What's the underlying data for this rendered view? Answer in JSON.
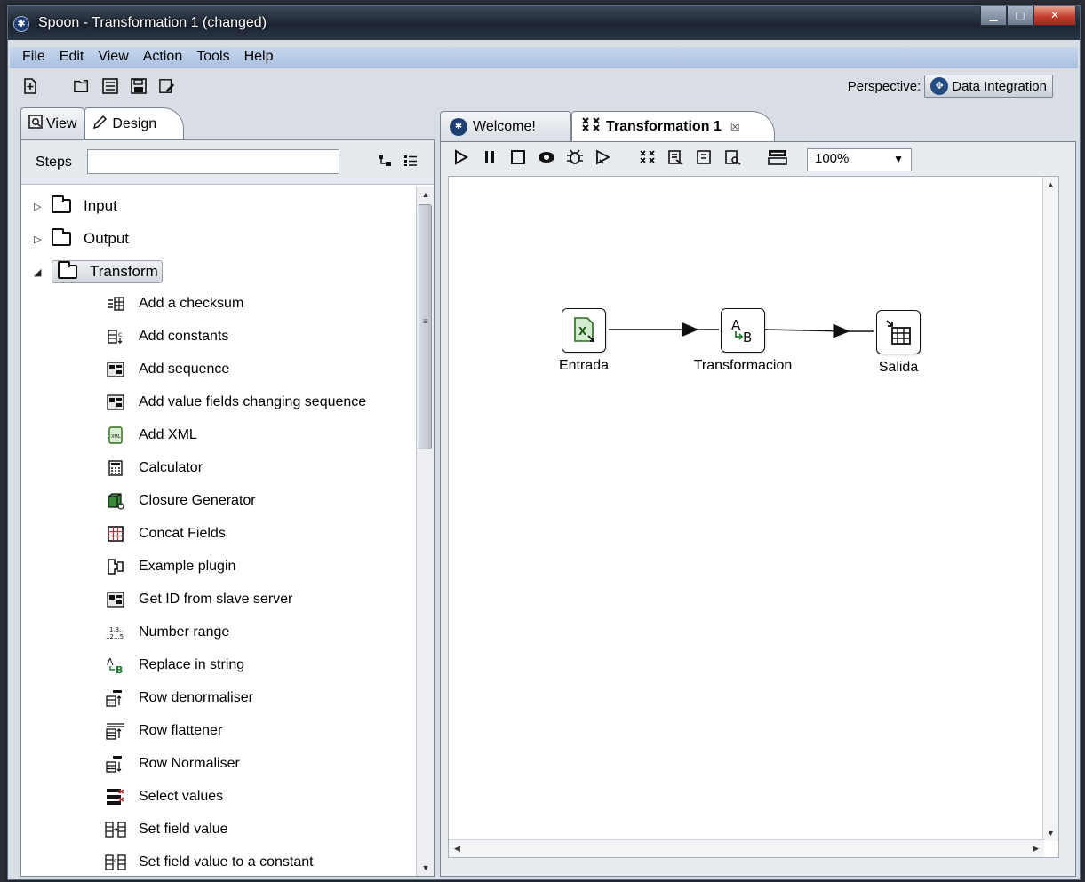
{
  "window": {
    "title": "Spoon - Transformation 1 (changed)",
    "app_icon": "spoon-icon",
    "controls": [
      "minimize",
      "maximize",
      "close"
    ]
  },
  "menu": [
    "File",
    "Edit",
    "View",
    "Action",
    "Tools",
    "Help"
  ],
  "toolbar": {
    "icons": [
      "new-file-icon",
      "open-file-icon",
      "explore-repository-icon",
      "save-icon",
      "save-as-icon"
    ]
  },
  "perspective": {
    "label": "Perspective:",
    "value": "Data Integration"
  },
  "left_panel": {
    "tabs": [
      {
        "label": "View",
        "icon": "view-icon"
      },
      {
        "label": "Design",
        "icon": "pencil-icon"
      }
    ],
    "steps_label": "Steps",
    "search_value": "",
    "categories": [
      {
        "label": "Input",
        "expanded": false
      },
      {
        "label": "Output",
        "expanded": false
      },
      {
        "label": "Transform",
        "expanded": true,
        "selected": true
      }
    ],
    "transform_steps": [
      {
        "label": "Add a checksum",
        "icon": "checksum-icon"
      },
      {
        "label": "Add constants",
        "icon": "constants-icon"
      },
      {
        "label": "Add sequence",
        "icon": "sequence-icon"
      },
      {
        "label": "Add value fields changing sequence",
        "icon": "sequence-icon"
      },
      {
        "label": "Add XML",
        "icon": "xml-icon"
      },
      {
        "label": "Calculator",
        "icon": "calculator-icon"
      },
      {
        "label": "Closure Generator",
        "icon": "closure-icon"
      },
      {
        "label": "Concat Fields",
        "icon": "concat-icon"
      },
      {
        "label": "Example plugin",
        "icon": "plugin-icon"
      },
      {
        "label": "Get ID from slave server",
        "icon": "sequence-icon"
      },
      {
        "label": "Number range",
        "icon": "number-range-icon"
      },
      {
        "label": "Replace in string",
        "icon": "replace-icon"
      },
      {
        "label": "Row denormaliser",
        "icon": "denormaliser-icon"
      },
      {
        "label": "Row flattener",
        "icon": "flattener-icon"
      },
      {
        "label": "Row Normaliser",
        "icon": "normaliser-icon"
      },
      {
        "label": "Select values",
        "icon": "select-values-icon"
      },
      {
        "label": "Set field value",
        "icon": "set-field-icon"
      },
      {
        "label": "Set field value to a constant",
        "icon": "set-constant-icon"
      }
    ]
  },
  "right_panel": {
    "tabs": [
      {
        "label": "Welcome!",
        "icon": "globe-icon",
        "active": false
      },
      {
        "label": "Transformation 1",
        "icon": "transformation-icon",
        "active": true
      }
    ],
    "canvas_tools": [
      "run-icon",
      "pause-icon",
      "stop-icon",
      "preview-icon",
      "debug-icon",
      "replay-icon",
      "verify-icon",
      "impact-icon",
      "sql-icon",
      "explore-db-icon",
      "results-icon"
    ],
    "zoom": "100%",
    "steps": [
      {
        "label": "Entrada",
        "icon": "excel-input-icon"
      },
      {
        "label": "Transformacion",
        "icon": "replace-string-icon"
      },
      {
        "label": "Salida",
        "icon": "table-output-icon"
      }
    ]
  }
}
